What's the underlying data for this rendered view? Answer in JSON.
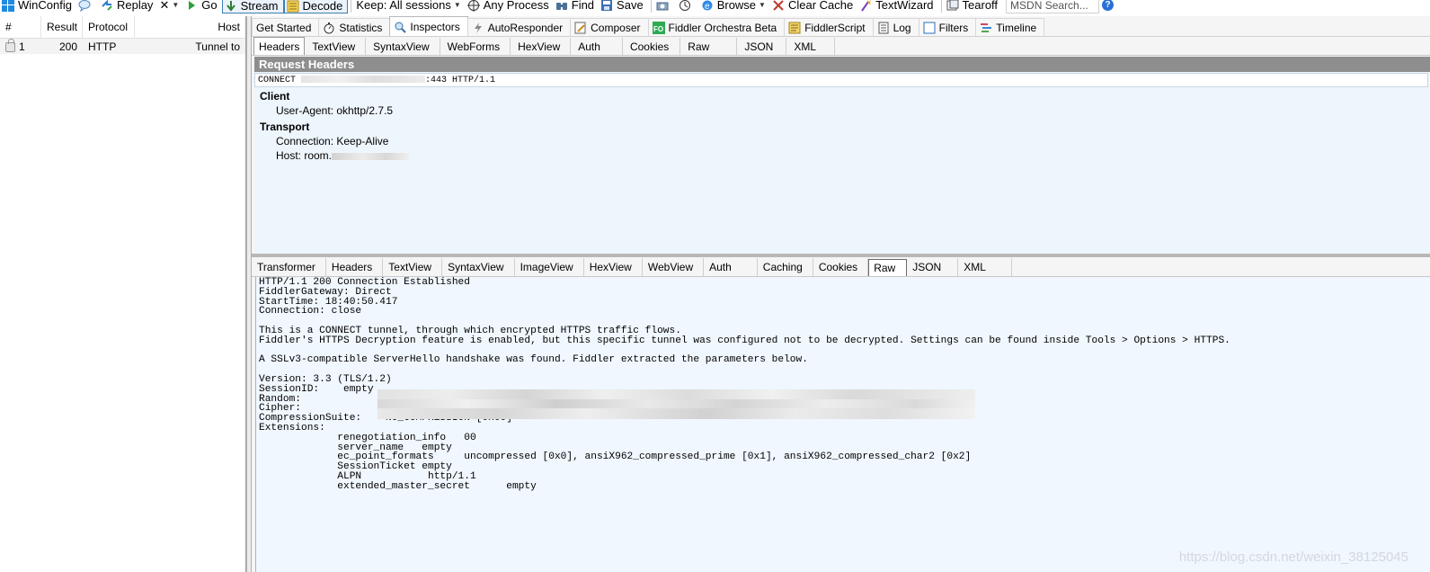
{
  "toolbar": {
    "winconfig": "WinConfig",
    "replay": "Replay",
    "remove": "✕",
    "go": "Go",
    "stream": "Stream",
    "decode": "Decode",
    "keep": "Keep: All sessions",
    "any_process": "Any Process",
    "find": "Find",
    "save": "Save",
    "browse": "Browse",
    "clear_cache": "Clear Cache",
    "textwizard": "TextWizard",
    "tearoff": "Tearoff",
    "msdn_placeholder": "MSDN Search..."
  },
  "sessions": {
    "columns": [
      "#",
      "Result",
      "Protocol",
      "Host"
    ],
    "rows": [
      {
        "num": "1",
        "result": "200",
        "protocol": "HTTP",
        "host": "Tunnel to"
      }
    ]
  },
  "main_tabs": [
    {
      "label": "Get Started",
      "icon": "none"
    },
    {
      "label": "Statistics",
      "icon": "stopwatch-icon"
    },
    {
      "label": "Inspectors",
      "icon": "inspect-icon"
    },
    {
      "label": "AutoResponder",
      "icon": "lightning-icon"
    },
    {
      "label": "Composer",
      "icon": "composer-icon"
    },
    {
      "label": "Fiddler Orchestra Beta",
      "icon": "fo-icon"
    },
    {
      "label": "FiddlerScript",
      "icon": "script-icon"
    },
    {
      "label": "Log",
      "icon": "log-icon"
    },
    {
      "label": "Filters",
      "icon": "filter-icon"
    },
    {
      "label": "Timeline",
      "icon": "timeline-icon"
    }
  ],
  "request_tabs": [
    "Headers",
    "TextView",
    "SyntaxView",
    "WebForms",
    "HexView",
    "Auth",
    "Cookies",
    "Raw",
    "JSON",
    "XML"
  ],
  "request": {
    "title": "Request Headers",
    "line_prefix": "CONNECT",
    "line_suffix": ":443 HTTP/1.1",
    "groups": [
      {
        "name": "Client",
        "items": [
          "User-Agent: okhttp/2.7.5"
        ]
      },
      {
        "name": "Transport",
        "items": [
          "Connection: Keep-Alive",
          "Host: room."
        ]
      }
    ]
  },
  "response_tabs": [
    "Transformer",
    "Headers",
    "TextView",
    "SyntaxView",
    "ImageView",
    "HexView",
    "WebView",
    "Auth",
    "Caching",
    "Cookies",
    "Raw",
    "JSON",
    "XML"
  ],
  "response": {
    "lines": [
      "HTTP/1.1 200 Connection Established",
      "FiddlerGateway: Direct",
      "StartTime: 18:40:50.417",
      "Connection: close",
      "",
      "This is a CONNECT tunnel, through which encrypted HTTPS traffic flows.",
      "Fiddler's HTTPS Decryption feature is enabled, but this specific tunnel was configured not to be decrypted. Settings can be found inside Tools > Options > HTTPS.",
      "",
      "A SSLv3-compatible ServerHello handshake was found. Fiddler extracted the parameters below.",
      "",
      "Version: 3.3 (TLS/1.2)",
      "SessionID:    empty",
      "Random:",
      "Cipher:",
      "CompressionSuite:    NO_COMPRESSION [0x00]",
      "Extensions:",
      "             renegotiation_info   00",
      "             server_name   empty",
      "             ec_point_formats     uncompressed [0x0], ansiX962_compressed_prime [0x1], ansiX962_compressed_char2 [0x2]",
      "             SessionTicket empty",
      "             ALPN           http/1.1",
      "             extended_master_secret      empty"
    ]
  },
  "watermark": "https://blog.csdn.net/weixin_38125045",
  "colors": {
    "request_bg": "#eef6fd",
    "title_bar": "#8e8e8e",
    "response_bg": "#f0f7fe"
  }
}
